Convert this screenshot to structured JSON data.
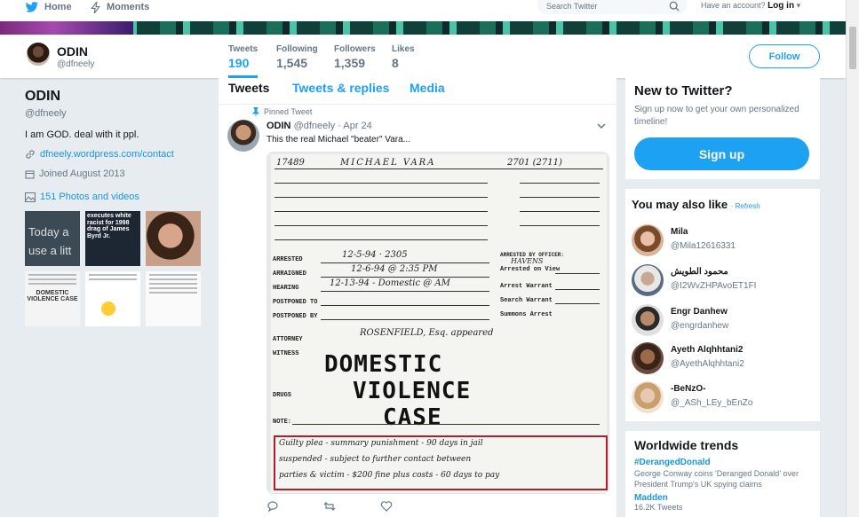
{
  "topnav": {
    "home_label": "Home",
    "moments_label": "Moments",
    "search_placeholder": "Search Twitter",
    "account_prompt": "Have an account?",
    "login_label": "Log in"
  },
  "profile_bar": {
    "name": "ODIN",
    "handle": "@dfneely",
    "stats": [
      {
        "label": "Tweets",
        "value": "190"
      },
      {
        "label": "Following",
        "value": "1,545"
      },
      {
        "label": "Followers",
        "value": "1,359"
      },
      {
        "label": "Likes",
        "value": "8"
      }
    ],
    "follow_label": "Follow"
  },
  "profile": {
    "name": "ODIN",
    "handle": "@dfneely",
    "bio": "I am GOD. deal with it ppl.",
    "website": "dfneely.wordpress.com/contact",
    "joined": "Joined August 2013",
    "photos_label": "151 Photos and videos",
    "thumb1_text": "Today a use a litt",
    "thumb2_text": "executes white racist for 1998 drag of James Byrd Jr.",
    "thumb4_text": "DOMESTIC VIOLENCE CASE"
  },
  "timeline": {
    "tabs": [
      "Tweets",
      "Tweets & replies",
      "Media"
    ],
    "pinned_label": "Pinned Tweet",
    "tweet": {
      "name": "ODIN",
      "handle": "@dfneely",
      "date": "· Apr 24",
      "text": "This the real Michael \"beater\" Vara..."
    },
    "document": {
      "id": "17489",
      "name": "MICHAEL VARA",
      "code": "2701 (2711)",
      "arrested": "12-5-94 · 2305",
      "arraigned": "12-6-94 @ 2:35 PM",
      "hearing": "12-13-94 - Domestic @ AM",
      "officer": "HAVENS",
      "attorney": "ROSENFIELD, Esq. appeared",
      "stamp1": "DOMESTIC",
      "stamp2": "VIOLENCE",
      "stamp3": "CASE",
      "labels": {
        "arrested": "ARRESTED",
        "arraigned": "ARRAIGNED",
        "hearing": "HEARING",
        "postponed_to": "POSTPONED TO",
        "postponed_by": "POSTPONED BY",
        "attorney": "ATTORNEY",
        "witness": "WITNESS",
        "drugs": "DRUGS",
        "note": "NOTE:",
        "arrested_by": "ARRESTED BY OFFICER:",
        "arrested_on": "Arrested on View",
        "arrest_warrant": "Arrest Warrant",
        "search_warrant": "Search Warrant",
        "summons": "Summons Arrest"
      },
      "note_lines": [
        "Guilty plea - summary punishment - 90 days in jail",
        "suspended - subject to further contact between",
        "parties & victim - $200 fine plus costs - 60 days to pay"
      ]
    }
  },
  "sidebar": {
    "new_title": "New to Twitter?",
    "new_sub": "Sign up now to get your own personalized timeline!",
    "signup_label": "Sign up",
    "like_title": "You may also like",
    "refresh_label": "· Refresh",
    "suggestions": [
      {
        "name": "Mila",
        "handle": "@Mila12616331"
      },
      {
        "name": "محمود الطويش",
        "handle": "@I2WvZHPAvoET1FI"
      },
      {
        "name": "Engr Danhew",
        "handle": "@engrdanhew"
      },
      {
        "name": "Ayeth Alqhhtani2",
        "handle": "@AyethAlqhhtani2"
      },
      {
        "name": "-BeNzO-",
        "handle": "@_ASh_LEy_bEnZo"
      }
    ],
    "trends_title": "Worldwide trends",
    "trends": [
      {
        "tag": "#DerangedDonald",
        "desc": "George Conway coins 'Deranged Donald' over President Trump's UK spying claims"
      },
      {
        "tag": "Madden",
        "count": "16.2K Tweets"
      }
    ]
  },
  "colors": {
    "accent": "#1da1f2",
    "background": "#e6ecf0",
    "highlight_box": "#b21e2a"
  }
}
